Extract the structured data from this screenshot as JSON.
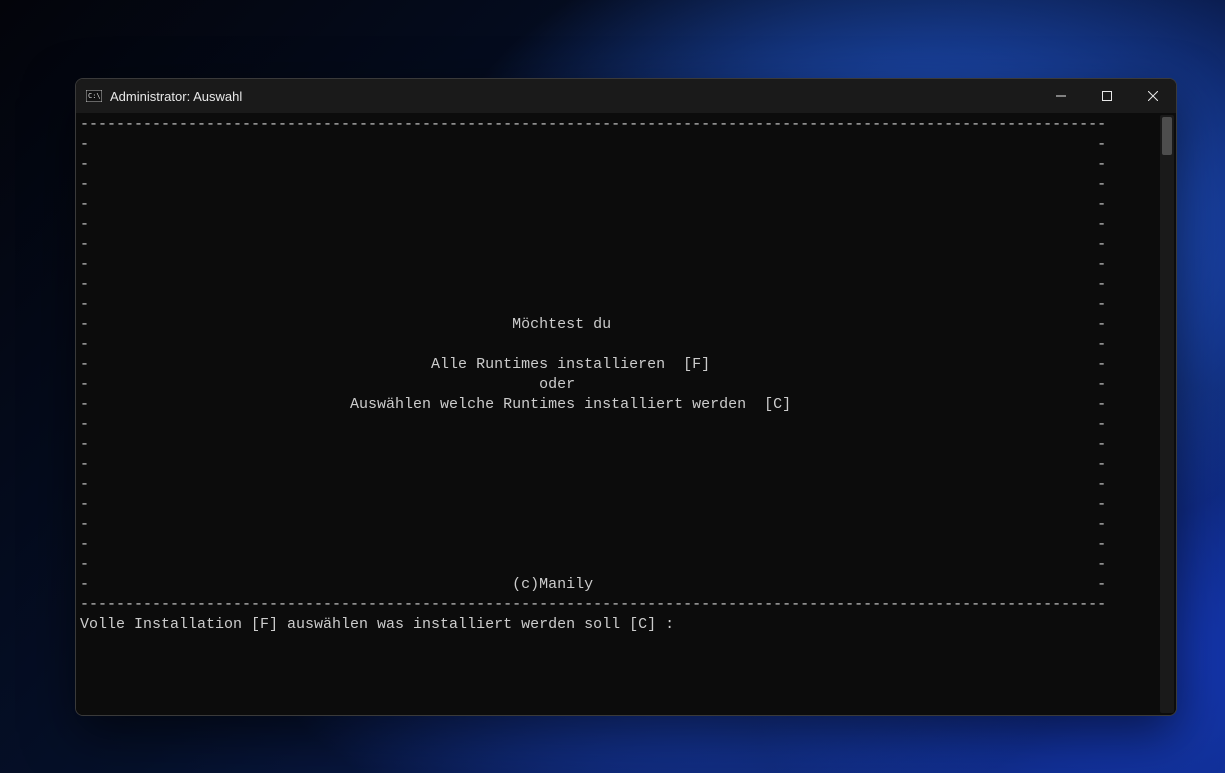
{
  "window": {
    "title": "Administrator:  Auswahl"
  },
  "content": {
    "line_top": "------------------------------------------------------------------------------------------------------------------",
    "side_only": "-                                                                                                                -",
    "l_title": "-                                               Möchtest du                                                      -",
    "l_all": "-                                      Alle Runtimes installieren  [F]                                           -",
    "l_or": "-                                                  oder                                                          -",
    "l_choose": "-                             Auswählen welche Runtimes installiert werden  [C]                                  -",
    "l_credit": "-                                               (c)Manily                                                        -",
    "line_bottom": "------------------------------------------------------------------------------------------------------------------",
    "prompt": "Volle Installation [F] auswählen was installiert werden soll [C] :"
  }
}
